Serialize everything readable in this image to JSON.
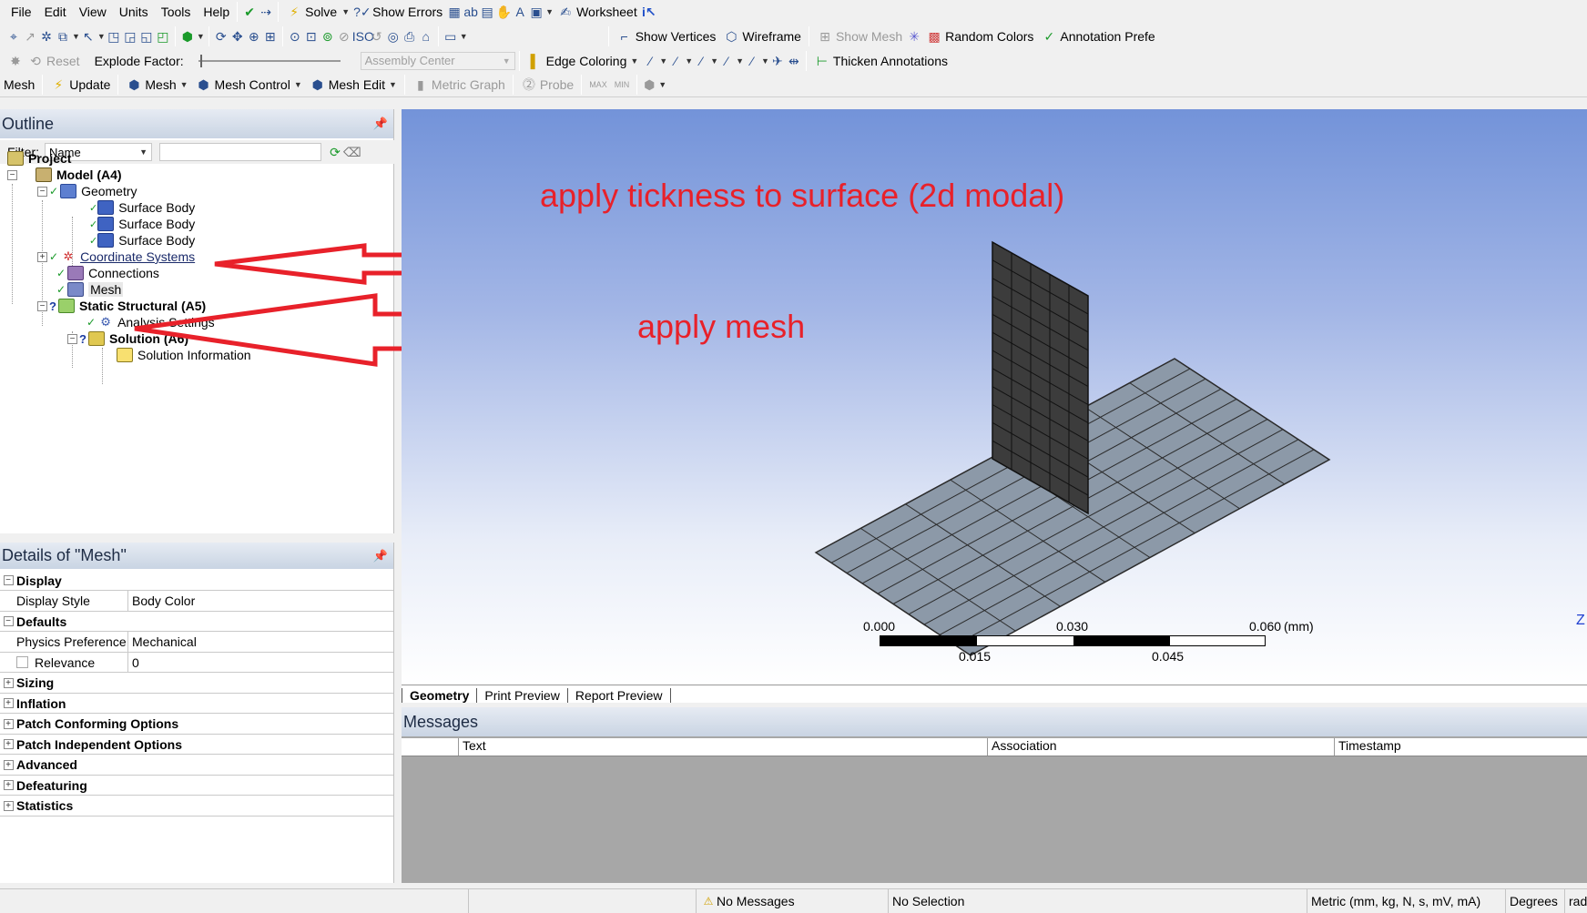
{
  "menu": [
    "File",
    "Edit",
    "View",
    "Units",
    "Tools",
    "Help"
  ],
  "toolbar1": {
    "solve": "Solve",
    "show_errors": "Show Errors",
    "worksheet": "Worksheet"
  },
  "toolbar2": {
    "show_vertices": "Show Vertices",
    "wireframe": "Wireframe",
    "show_mesh": "Show Mesh",
    "random_colors": "Random Colors",
    "annotation_prefs": "Annotation Prefe"
  },
  "toolbar3": {
    "reset": "Reset",
    "explode_factor": "Explode Factor:",
    "assembly_center": "Assembly Center",
    "edge_coloring": "Edge Coloring",
    "thicken_annotations": "Thicken Annotations"
  },
  "toolbar4": {
    "mesh": "Mesh",
    "update": "Update",
    "mesh_menu": "Mesh",
    "mesh_control": "Mesh Control",
    "mesh_edit": "Mesh Edit",
    "metric_graph": "Metric Graph",
    "probe": "Probe",
    "max": "MAX",
    "min": "MIN"
  },
  "outline": {
    "title": "Outline",
    "filter_label": "Filter:",
    "filter_value": "Name",
    "items": [
      {
        "label": "Project"
      },
      {
        "label": "Model (A4)"
      },
      {
        "label": "Geometry"
      },
      {
        "label": "Surface Body"
      },
      {
        "label": "Surface Body"
      },
      {
        "label": "Surface Body"
      },
      {
        "label": "Coordinate Systems"
      },
      {
        "label": "Connections"
      },
      {
        "label": "Mesh"
      },
      {
        "label": "Static Structural (A5)"
      },
      {
        "label": "Analysis Settings"
      },
      {
        "label": "Solution (A6)"
      },
      {
        "label": "Solution Information"
      }
    ]
  },
  "details": {
    "title": "Details of \"Mesh\"",
    "rows": [
      {
        "name": "Display",
        "value": ""
      },
      {
        "name": "Display Style",
        "value": "Body Color"
      },
      {
        "name": "Defaults",
        "value": ""
      },
      {
        "name": "Physics Preference",
        "value": "Mechanical"
      },
      {
        "name": "Relevance",
        "value": "0"
      },
      {
        "name": "Sizing",
        "value": ""
      },
      {
        "name": "Inflation",
        "value": ""
      },
      {
        "name": "Patch Conforming Options",
        "value": ""
      },
      {
        "name": "Patch Independent Options",
        "value": ""
      },
      {
        "name": "Advanced",
        "value": ""
      },
      {
        "name": "Defeaturing",
        "value": ""
      },
      {
        "name": "Statistics",
        "value": ""
      }
    ]
  },
  "annotations": {
    "surface_note": "apply tickness to surface (2d modal)",
    "mesh_note": "apply mesh"
  },
  "scale": {
    "top_labels": [
      "0.000",
      "0.030",
      "0.060"
    ],
    "unit": "(mm)",
    "bottom_labels": [
      "0.015",
      "0.045"
    ]
  },
  "axis_label": "Z",
  "view_tabs": [
    "Geometry",
    "Print Preview",
    "Report Preview"
  ],
  "messages": {
    "title": "Messages",
    "columns": [
      "Text",
      "Association",
      "Timestamp"
    ]
  },
  "status": {
    "messages": "No Messages",
    "selection": "No Selection",
    "units": "Metric (mm, kg, N, s, mV, mA)",
    "angle": "Degrees",
    "rad": "rad"
  },
  "colors": {
    "viewport_top": "#7393d9",
    "viewport_bottom": "#ffffff",
    "annotation_red": "#e8212a",
    "mesh_plane": "#8c99a8",
    "mesh_wall": "#3c3c3c"
  }
}
